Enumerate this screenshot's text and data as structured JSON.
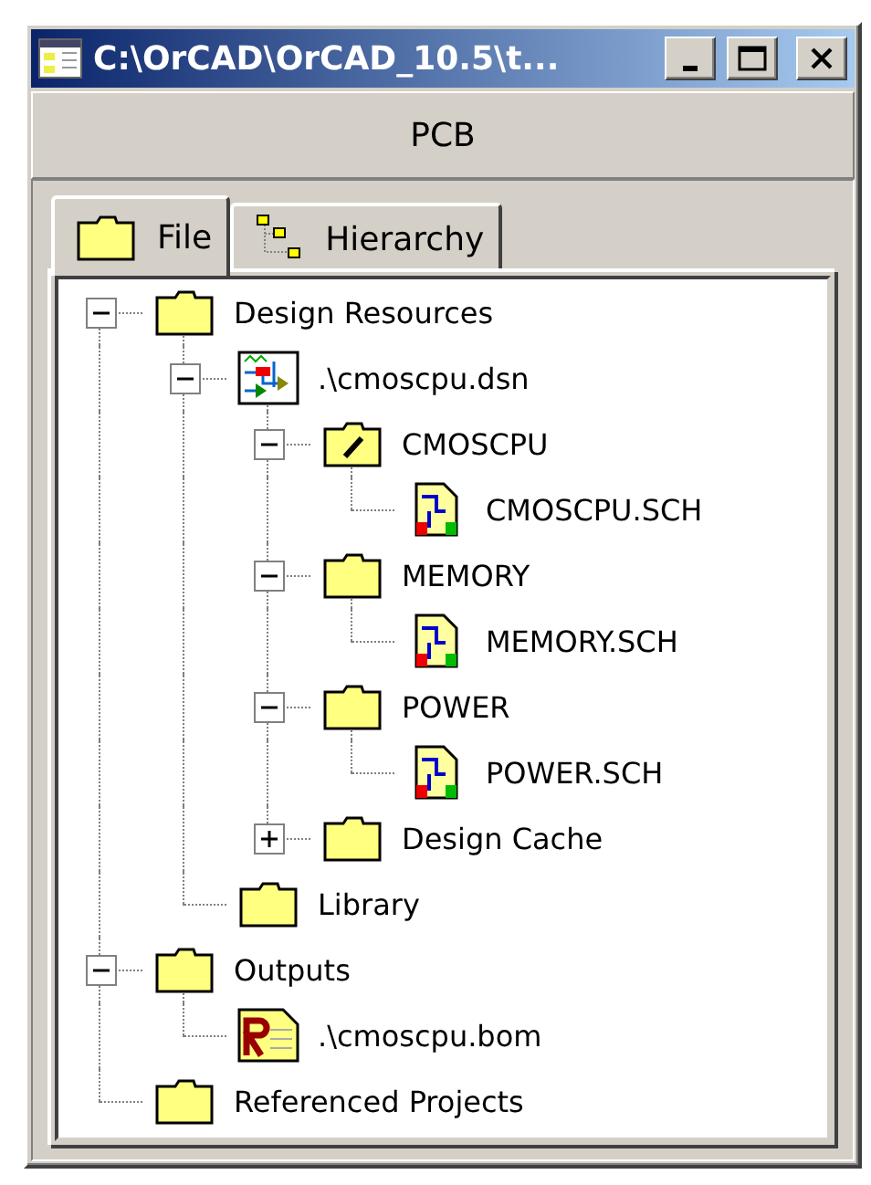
{
  "window": {
    "title": "C:\\OrCAD\\OrCAD_10.5\\t..."
  },
  "header": {
    "label": "PCB"
  },
  "tabs": [
    {
      "label": "File",
      "kind": "folder",
      "selected": true
    },
    {
      "label": "Hierarchy",
      "kind": "hierarchy",
      "selected": false
    }
  ],
  "tree": [
    {
      "label": "Design Resources",
      "kind": "folder",
      "expanded": true,
      "children": [
        {
          "label": ".\\cmoscpu.dsn",
          "kind": "design",
          "expanded": true,
          "children": [
            {
              "label": "CMOSCPU",
              "kind": "root-folder",
              "expanded": true,
              "children": [
                {
                  "label": "CMOSCPU.SCH",
                  "kind": "schematic"
                }
              ]
            },
            {
              "label": "MEMORY",
              "kind": "folder",
              "expanded": true,
              "children": [
                {
                  "label": "MEMORY.SCH",
                  "kind": "schematic"
                }
              ]
            },
            {
              "label": "POWER",
              "kind": "folder",
              "expanded": true,
              "children": [
                {
                  "label": "POWER.SCH",
                  "kind": "schematic"
                }
              ]
            },
            {
              "label": "Design Cache",
              "kind": "folder",
              "expanded": false
            }
          ]
        },
        {
          "label": "Library",
          "kind": "folder"
        }
      ]
    },
    {
      "label": "Outputs",
      "kind": "folder",
      "expanded": true,
      "children": [
        {
          "label": ".\\cmoscpu.bom",
          "kind": "bom"
        }
      ]
    },
    {
      "label": "Referenced Projects",
      "kind": "folder"
    }
  ]
}
